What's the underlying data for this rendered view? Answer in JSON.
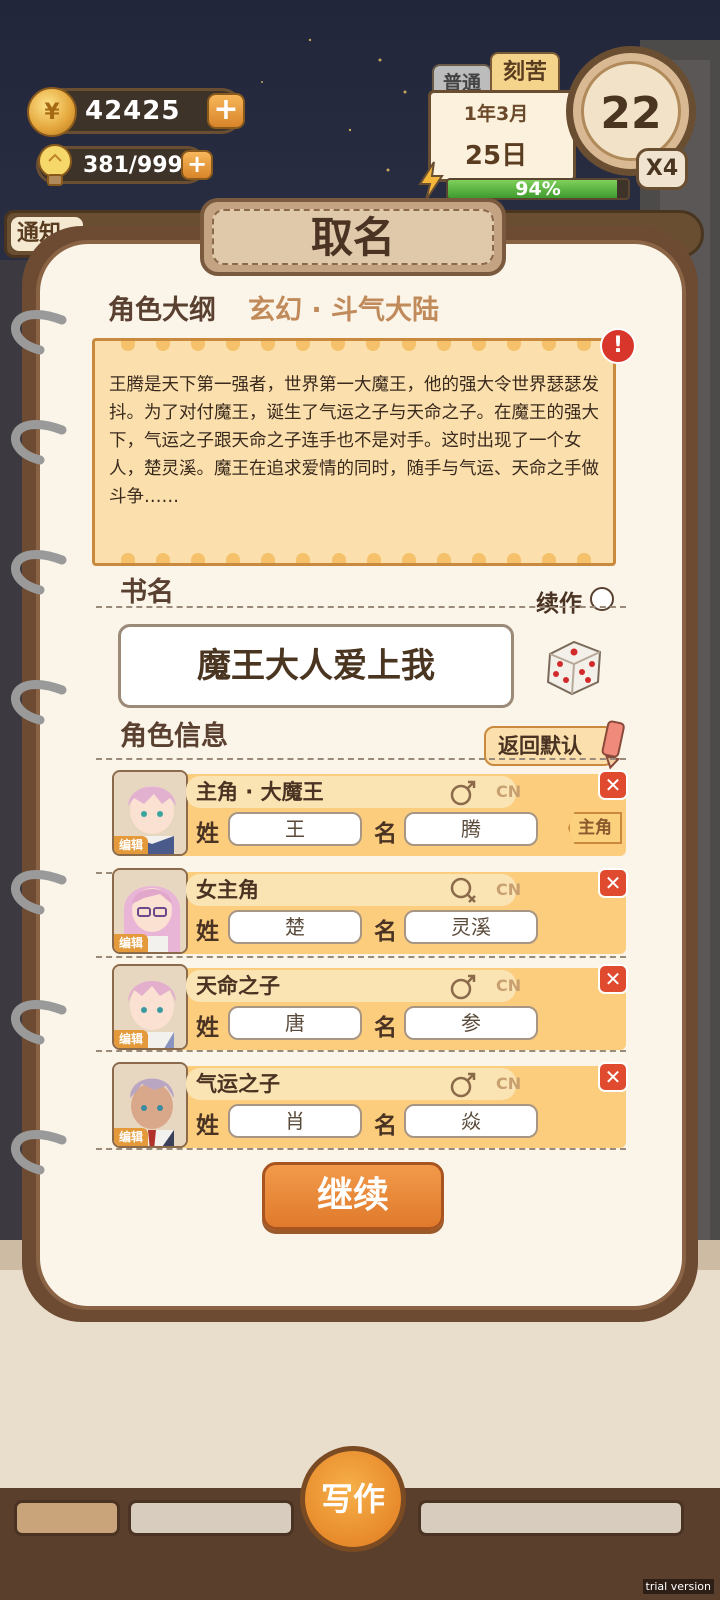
{
  "hud": {
    "coins": "42425",
    "energy": "381/999",
    "mode_normal": "普通",
    "mode_hard": "刻苦",
    "calendar_year_month": "1年3月",
    "calendar_day": "25日",
    "clock_value": "22",
    "speed": "X4",
    "progress_text": "94%",
    "progress_fraction": 0.94,
    "notice_label": "通知"
  },
  "dialog": {
    "title": "取名",
    "outline_label": "角色大纲",
    "genre": "玄幻 · 斗气大陆",
    "outline_text": "王腾是天下第一强者，世界第一大魔王，他的强大令世界瑟瑟发抖。为了对付魔王，诞生了气运之子与天命之子。在魔王的强大下，气运之子跟天命之子连手也不是对手。这时出现了一个女人，楚灵溪。魔王在追求爱情的同时，随手与气运、天命之手做斗争……",
    "book_name_label": "书名",
    "sequel_label": "续作",
    "book_name": "魔王大人爱上我",
    "roles_label": "角色信息",
    "reset_label": "返回默认",
    "continue_label": "继续"
  },
  "roles": [
    {
      "role": "主角 · 大魔王",
      "surname_label": "姓",
      "surname": "王",
      "given_label": "名",
      "given": "腾",
      "gender": "male",
      "cn": "CN",
      "edit": "编辑",
      "tag": "主角"
    },
    {
      "role": "女主角",
      "surname_label": "姓",
      "surname": "楚",
      "given_label": "名",
      "given": "灵溪",
      "gender": "female",
      "cn": "CN",
      "edit": "编辑"
    },
    {
      "role": "天命之子",
      "surname_label": "姓",
      "surname": "唐",
      "given_label": "名",
      "given": "参",
      "gender": "male",
      "cn": "CN",
      "edit": "编辑"
    },
    {
      "role": "气运之子",
      "surname_label": "姓",
      "surname": "肖",
      "given_label": "名",
      "given": "焱",
      "gender": "male",
      "cn": "CN",
      "edit": "编辑"
    }
  ],
  "bottom": {
    "write_label": "写作",
    "watermark": "trial version"
  },
  "colors": {
    "accent": "#e07a2c",
    "card": "#fbcd7d",
    "delete": "#e04a2e",
    "progress": "#4caf3a"
  }
}
